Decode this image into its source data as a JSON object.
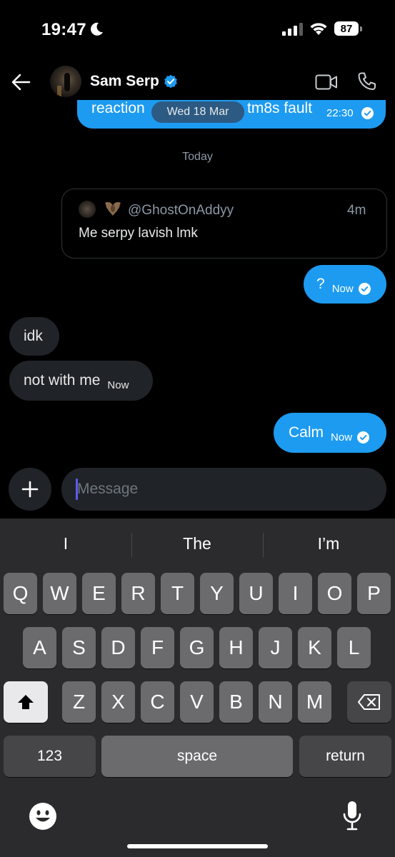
{
  "status_bar": {
    "time": "19:47",
    "battery": "87"
  },
  "header": {
    "name": "Sam Serp"
  },
  "previous_message": {
    "text_left": "reaction",
    "text_right": "tm8s fault",
    "time": "22:30",
    "date_pill": "Wed 18 Mar"
  },
  "day_separator": "Today",
  "quoted_post": {
    "handle": "@GhostOnAddyy",
    "time": "4m",
    "text": "Me serpy lavish lmk"
  },
  "messages": [
    {
      "text": "?",
      "time": "Now"
    },
    {
      "text": "idk"
    },
    {
      "text": "not with me",
      "time": "Now"
    },
    {
      "text": "Calm",
      "time": "Now"
    }
  ],
  "composer": {
    "placeholder": "Message"
  },
  "keyboard": {
    "suggestions": [
      "I",
      "The",
      "I’m"
    ],
    "row1": [
      "Q",
      "W",
      "E",
      "R",
      "T",
      "Y",
      "U",
      "I",
      "O",
      "P"
    ],
    "row2": [
      "A",
      "S",
      "D",
      "F",
      "G",
      "H",
      "J",
      "K",
      "L"
    ],
    "row3": [
      "Z",
      "X",
      "C",
      "V",
      "B",
      "N",
      "M"
    ],
    "numbers_label": "123",
    "space_label": "space",
    "return_label": "return"
  },
  "colors": {
    "accent": "#1d9bf0",
    "incoming_bubble": "#202327",
    "background": "#000000"
  },
  "icons": [
    "moon-icon",
    "signal-icon",
    "wifi-icon",
    "battery-icon",
    "back-arrow-icon",
    "verified-badge-icon",
    "video-call-icon",
    "phone-call-icon",
    "read-check-icon",
    "plus-icon",
    "shift-icon",
    "backspace-icon",
    "emoji-icon",
    "microphone-icon"
  ]
}
